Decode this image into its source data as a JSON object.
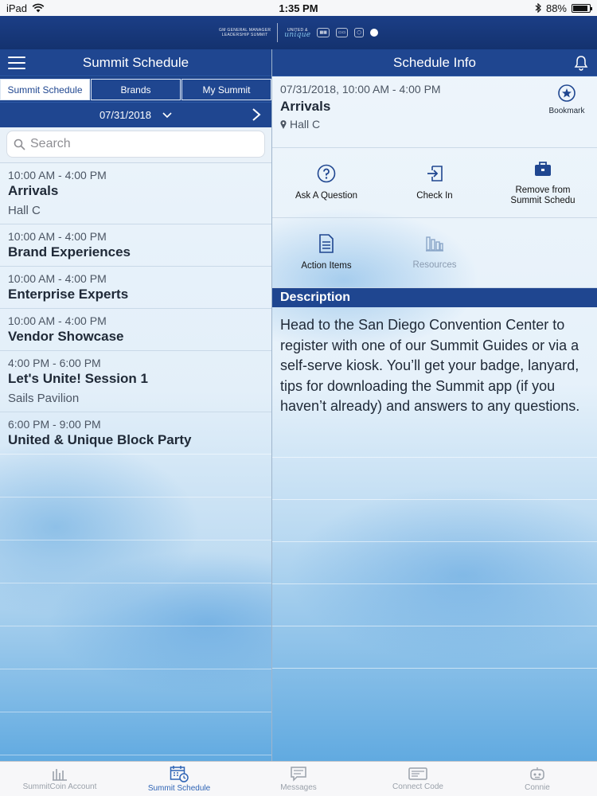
{
  "status_bar": {
    "device": "iPad",
    "time": "1:35 PM",
    "battery": "88%",
    "battery_level": 0.88
  },
  "banner": {
    "logo_line1": "GM GENERAL MANAGER",
    "logo_line2": "LEADERSHIP SUMMIT",
    "logo_united": "UNITED &",
    "logo_unique": "unique"
  },
  "left": {
    "title": "Summit Schedule",
    "segments": [
      "Summit Schedule",
      "Brands",
      "My Summit"
    ],
    "active_segment": 0,
    "date": "07/31/2018",
    "search_placeholder": "Search",
    "items": [
      {
        "time": "10:00 AM - 4:00 PM",
        "title": "Arrivals",
        "location": "Hall C"
      },
      {
        "time": "10:00 AM - 4:00 PM",
        "title": "Brand Experiences",
        "location": ""
      },
      {
        "time": "10:00 AM - 4:00 PM",
        "title": "Enterprise Experts",
        "location": ""
      },
      {
        "time": "10:00 AM - 4:00 PM",
        "title": "Vendor Showcase",
        "location": ""
      },
      {
        "time": "4:00 PM - 6:00 PM",
        "title": "Let's Unite! Session 1",
        "location": "Sails Pavilion"
      },
      {
        "time": "6:00 PM - 9:00 PM",
        "title": "United & Unique Block Party",
        "location": ""
      }
    ]
  },
  "right": {
    "title": "Schedule Info",
    "datetime": "07/31/2018, 10:00 AM - 4:00 PM",
    "event_title": "Arrivals",
    "location": "Hall C",
    "bookmark_label": "Bookmark",
    "actions": {
      "ask": "Ask A Question",
      "checkin": "Check In",
      "remove_line1": "Remove from",
      "remove_line2": "Summit Schedu",
      "action_items": "Action Items",
      "resources": "Resources"
    },
    "description_header": "Description",
    "description": "Head to the San Diego Convention Center to register with one of our Summit Guides or via a self-serve kiosk. You’ll get your badge, lanyard, tips for downloading the Summit app (if you haven’t already) and answers to any questions."
  },
  "tabbar": {
    "tabs": [
      "SummitCoin Account",
      "Summit Schedule",
      "Messages",
      "Connect Code",
      "Connie"
    ],
    "active": 1
  },
  "colors": {
    "navy": "#1f4690",
    "accent": "#2f64b5"
  }
}
